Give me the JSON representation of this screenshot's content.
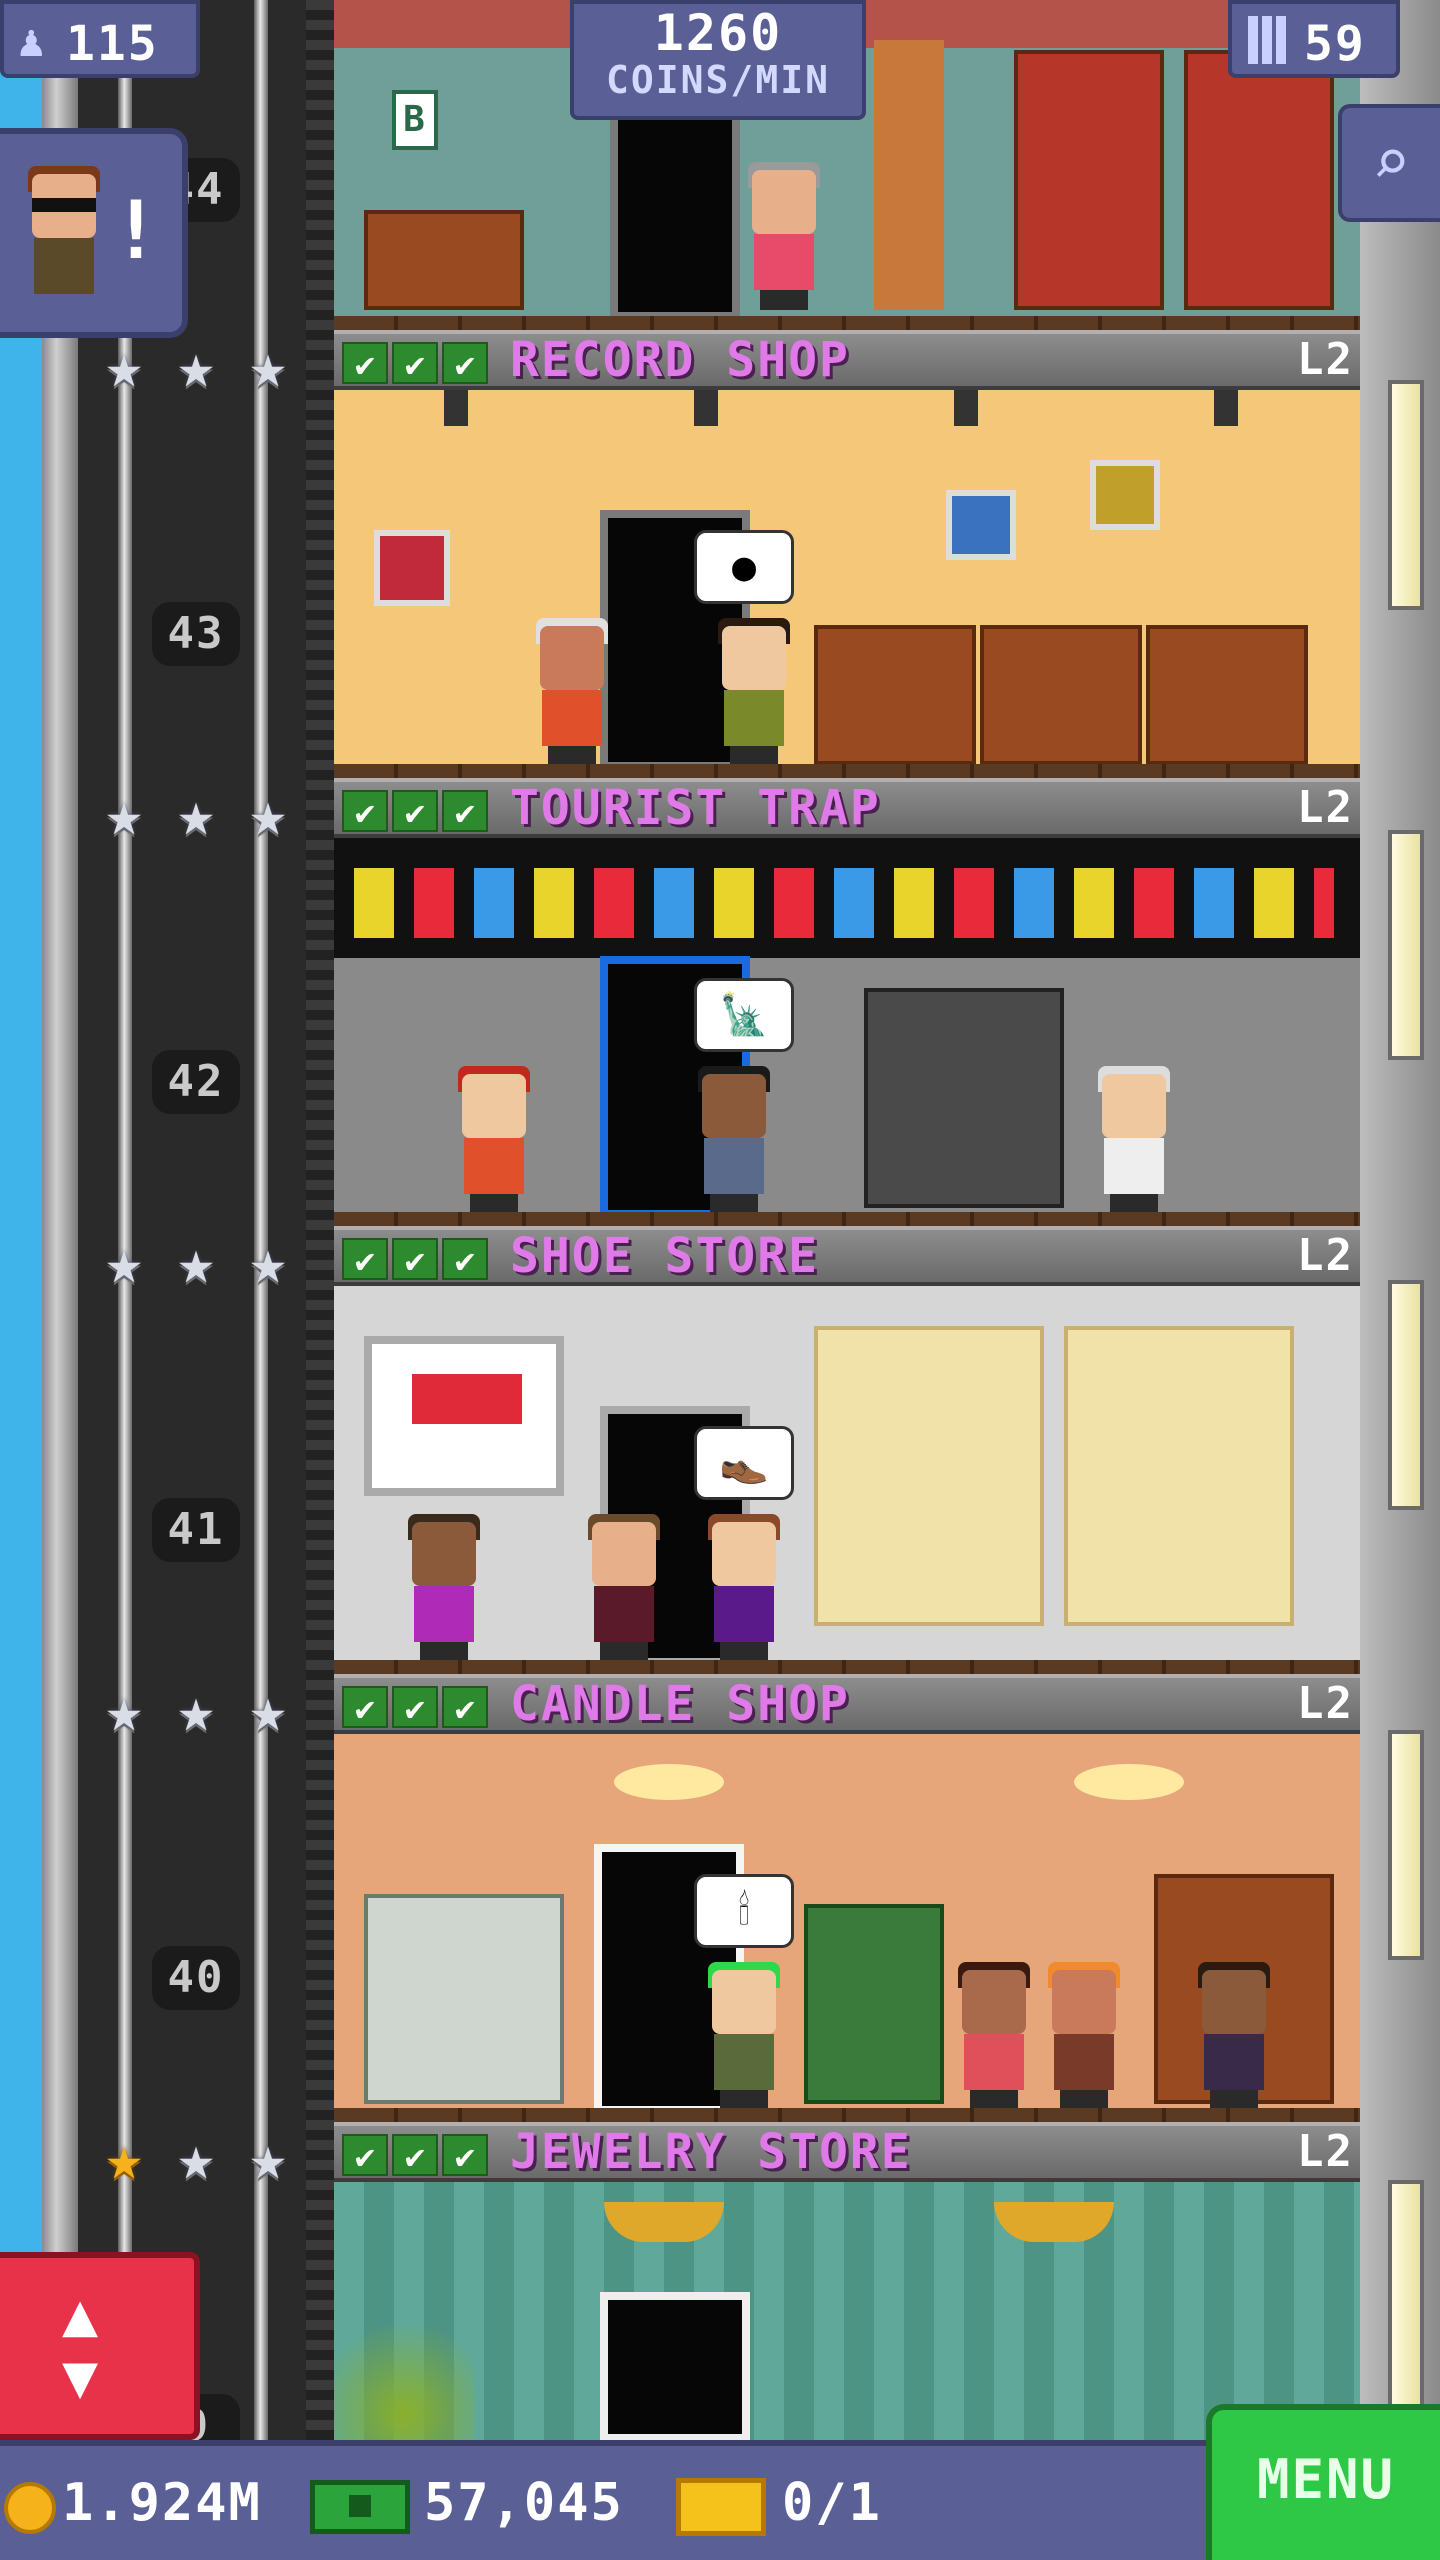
{
  "hud": {
    "population": "115",
    "coins_per_min_value": "1260",
    "coins_per_min_label": "COINS/MIN",
    "floor_count": "59"
  },
  "shaft": {
    "floor_numbers": [
      "44",
      "43",
      "42",
      "41",
      "40",
      "9"
    ]
  },
  "floors": [
    {
      "name": "RECORD SHOP",
      "level": "L2",
      "checks": 3,
      "stars_gold": 0
    },
    {
      "name": "TOURIST TRAP",
      "level": "L2",
      "checks": 3,
      "stars_gold": 0
    },
    {
      "name": "SHOE STORE",
      "level": "L2",
      "checks": 3,
      "stars_gold": 0
    },
    {
      "name": "CANDLE SHOP",
      "level": "L2",
      "checks": 3,
      "stars_gold": 0
    },
    {
      "name": "JEWELRY STORE",
      "level": "L2",
      "checks": 3,
      "stars_gold": 1
    }
  ],
  "top_floor_sign": "B",
  "bottom_bar": {
    "coins": "1.924M",
    "bux": "57,045",
    "tickets": "0/1",
    "menu_label": "MENU"
  },
  "icons": {
    "population": "person-icon",
    "floors": "building-icon",
    "search": "magnifier-icon",
    "elevator": "up-down-arrows-icon"
  },
  "colors": {
    "hud_bg": "#5a5f96",
    "shop_name": "#e07ae8",
    "menu_green": "#2fc846",
    "elevator_red": "#e8324a",
    "check_green": "#2e8a2e"
  }
}
